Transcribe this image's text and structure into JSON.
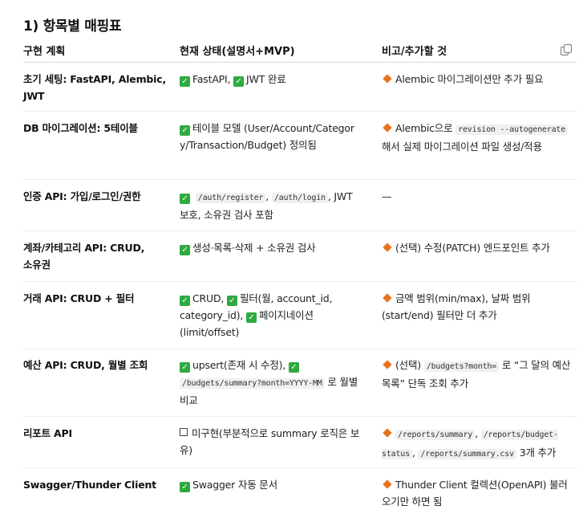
{
  "title": "1) 항목별 매핑표",
  "headers": [
    "구현 계획",
    "현재 상태(설명서+MVP)",
    "비고/추가할 것"
  ],
  "copy_icon": "copy-icon",
  "rows": [
    {
      "plan": "초기 세팅: FastAPI, Alembic, JWT",
      "status": {
        "a": "FastAPI,",
        "b": "JWT 완료"
      },
      "note": "Alembic 마이그레이션만 추가 필요"
    },
    {
      "plan": "DB 마이그레이션: 5테이블",
      "status": {
        "a": "테이블 모델 (User/Account/Category/Transaction/Budget) 정의됨"
      },
      "note": {
        "pre": "Alembic으로",
        "code1": "revision --autogenerate",
        "post": "해서 실제 마이그레이션 파일 생성/적용"
      }
    },
    {
      "plan": "인증 API: 가입/로그인/권한",
      "status": {
        "code1": "/auth/register",
        "sep": ",",
        "code2": "/auth/login",
        "post": ", JWT 보호, 소유권 검사 포함"
      },
      "note": "—"
    },
    {
      "plan": "계좌/카테고리 API: CRUD, 소유권",
      "status": {
        "a": "생성·목록·삭제 + 소유권 검사"
      },
      "note": "(선택) 수정(PATCH) 엔드포인트 추가"
    },
    {
      "plan": "거래 API: CRUD + 필터",
      "status": {
        "a": "CRUD,",
        "b": "필터(월, account_id, category_id),",
        "c": "페이지네이션 (limit/offset)"
      },
      "note": "금액 범위(min/max), 날짜 범위 (start/end) 필터만 더 추가"
    },
    {
      "plan": "예산 API: CRUD, 월별 조회",
      "status": {
        "a": "upsert(존재 시 수정),",
        "code1": "/budgets/summary?month=YYYY-MM",
        "post": "로 월별 비교"
      },
      "note": {
        "pre": "(선택)",
        "code1": "/budgets?month=",
        "post": "로 “그 달의 예산 목록” 단독 조회 추가"
      }
    },
    {
      "plan": "리포트 API",
      "status": {
        "a": "미구현(부분적으로 summary 로직은 보유)"
      },
      "note": {
        "code1": "/reports/summary",
        "code2": "/reports/budget-status",
        "code3": "/reports/summary.csv",
        "post": "3개 추가"
      }
    },
    {
      "plan": "Swagger/Thunder Client",
      "status": {
        "a": "Swagger 자동 문서"
      },
      "note": "Thunder Client 컬렉션(OpenAPI) 불러오기만 하면 됨"
    }
  ]
}
